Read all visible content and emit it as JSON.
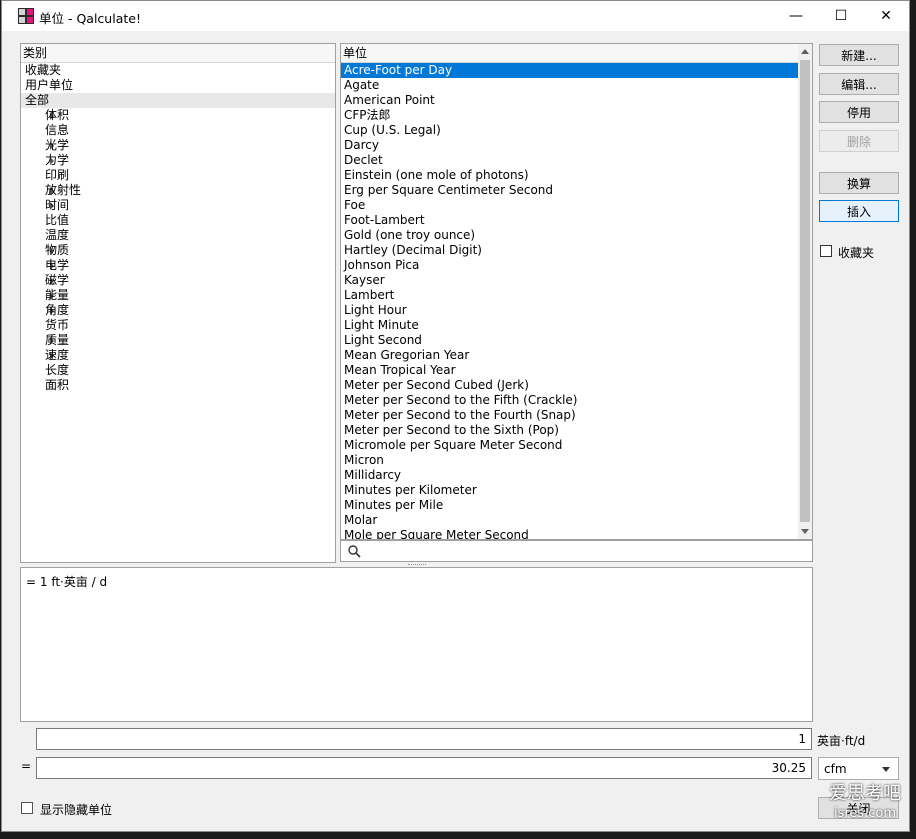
{
  "window": {
    "title": "单位 - Qalculate!",
    "minimize_glyph": "—",
    "maximize_glyph": "☐",
    "close_glyph": "✕"
  },
  "categories": {
    "header": "类别",
    "items": [
      {
        "label": "收藏夹",
        "indent": 0,
        "expandable": false,
        "selected": false
      },
      {
        "label": "用户单位",
        "indent": 0,
        "expandable": false,
        "selected": false
      },
      {
        "label": "全部",
        "indent": 0,
        "expandable": false,
        "selected": true
      },
      {
        "label": "体积",
        "indent": 1,
        "expandable": true,
        "selected": false
      },
      {
        "label": "信息",
        "indent": 1,
        "expandable": false,
        "selected": false
      },
      {
        "label": "光学",
        "indent": 1,
        "expandable": true,
        "selected": false
      },
      {
        "label": "力学",
        "indent": 1,
        "expandable": true,
        "selected": false
      },
      {
        "label": "印刷",
        "indent": 1,
        "expandable": false,
        "selected": false
      },
      {
        "label": "放射性",
        "indent": 1,
        "expandable": true,
        "selected": false
      },
      {
        "label": "时间",
        "indent": 1,
        "expandable": true,
        "selected": false
      },
      {
        "label": "比值",
        "indent": 1,
        "expandable": false,
        "selected": false
      },
      {
        "label": "温度",
        "indent": 1,
        "expandable": false,
        "selected": false
      },
      {
        "label": "物质",
        "indent": 1,
        "expandable": true,
        "selected": false
      },
      {
        "label": "电学",
        "indent": 1,
        "expandable": true,
        "selected": false
      },
      {
        "label": "磁学",
        "indent": 1,
        "expandable": true,
        "selected": false
      },
      {
        "label": "能量",
        "indent": 1,
        "expandable": true,
        "selected": false
      },
      {
        "label": "角度",
        "indent": 1,
        "expandable": true,
        "selected": false
      },
      {
        "label": "货币",
        "indent": 1,
        "expandable": false,
        "selected": false
      },
      {
        "label": "质量",
        "indent": 1,
        "expandable": true,
        "selected": false
      },
      {
        "label": "速度",
        "indent": 1,
        "expandable": true,
        "selected": false
      },
      {
        "label": "长度",
        "indent": 1,
        "expandable": false,
        "selected": false
      },
      {
        "label": "面积",
        "indent": 1,
        "expandable": false,
        "selected": false
      }
    ]
  },
  "units": {
    "header": "单位",
    "selected_index": 0,
    "items": [
      "Acre-Foot per Day",
      "Agate",
      "American Point",
      "CFP法郎",
      "Cup (U.S. Legal)",
      "Darcy",
      "Declet",
      "Einstein (one mole of photons)",
      "Erg per Square Centimeter Second",
      "Foe",
      "Foot-Lambert",
      "Gold (one troy ounce)",
      "Hartley (Decimal Digit)",
      "Johnson Pica",
      "Kayser",
      "Lambert",
      "Light Hour",
      "Light Minute",
      "Light Second",
      "Mean Gregorian Year",
      "Mean Tropical Year",
      "Meter per Second Cubed (Jerk)",
      "Meter per Second to the Fifth (Crackle)",
      "Meter per Second to the Fourth (Snap)",
      "Meter per Second to the Sixth (Pop)",
      "Micromole per Square Meter Second",
      "Micron",
      "Millidarcy",
      "Minutes per Kilometer",
      "Minutes per Mile",
      "Molar",
      "Mole per Square Meter Second"
    ],
    "search_placeholder": ""
  },
  "buttons": {
    "new": "新建...",
    "edit": "编辑...",
    "disable": "停用",
    "delete": "删除",
    "convert": "换算",
    "insert": "插入"
  },
  "favorite_label": "收藏夹",
  "description": "= 1 ft·英亩 / d",
  "conversion": {
    "from_value": "1",
    "from_unit": "英亩·ft/d",
    "equals": "=",
    "to_value": "30.25",
    "to_unit": "cfm"
  },
  "show_hidden_label": "显示隐藏单位",
  "close_label": "关闭",
  "watermark": {
    "line1": "爱思考吧",
    "line2": "isres.com"
  }
}
